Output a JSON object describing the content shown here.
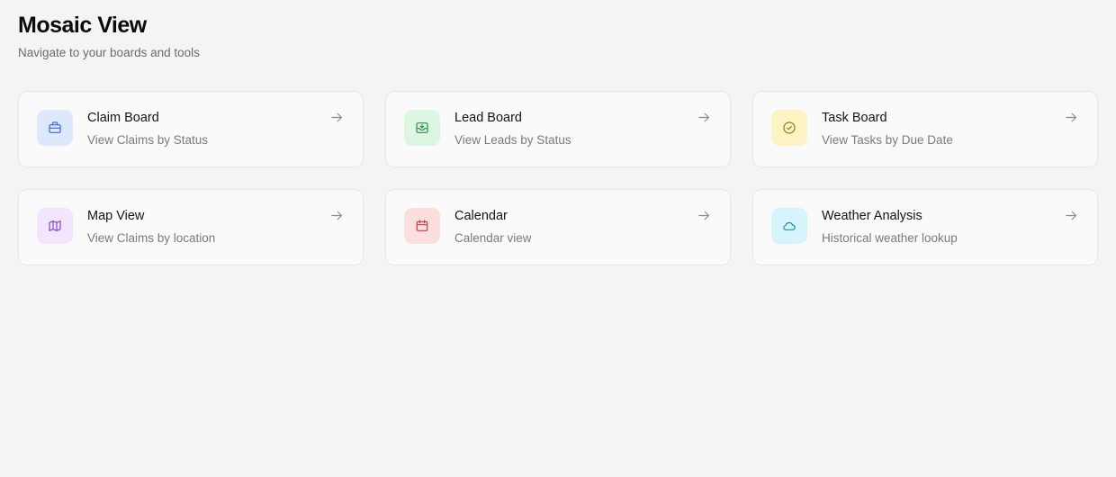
{
  "page": {
    "title": "Mosaic View",
    "subtitle": "Navigate to your boards and tools"
  },
  "cards": [
    {
      "title": "Claim Board",
      "description": "View Claims by Status",
      "icon": "briefcase-icon",
      "icon_bg": "#dde8fd",
      "icon_color": "#3d64d8"
    },
    {
      "title": "Lead Board",
      "description": "View Leads by Status",
      "icon": "inbox-icon",
      "icon_bg": "#dcf6e2",
      "icon_color": "#2f8f4e"
    },
    {
      "title": "Task Board",
      "description": "View Tasks by Due Date",
      "icon": "check-circle-icon",
      "icon_bg": "#fdf3c4",
      "icon_color": "#9a7410"
    },
    {
      "title": "Map View",
      "description": "View Claims by location",
      "icon": "map-icon",
      "icon_bg": "#f1e6fd",
      "icon_color": "#8a45d0"
    },
    {
      "title": "Calendar",
      "description": "Calendar view",
      "icon": "calendar-icon",
      "icon_bg": "#fbdfdf",
      "icon_color": "#cc3c3c"
    },
    {
      "title": "Weather Analysis",
      "description": "Historical weather lookup",
      "icon": "cloud-icon",
      "icon_bg": "#d6f4fb",
      "icon_color": "#1f8ea8"
    }
  ],
  "colors": {
    "background": "#f4f4f4",
    "card_background": "#fafafa",
    "card_border": "#e6e6e6",
    "arrow": "#8a8a8a"
  }
}
